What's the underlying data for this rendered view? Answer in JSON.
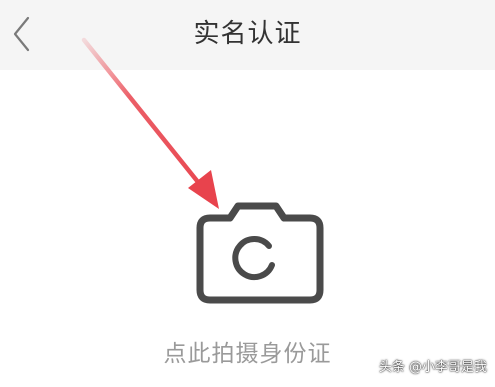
{
  "header": {
    "back_icon": "chevron-left-icon",
    "title": "实名认证"
  },
  "main": {
    "camera_icon": "camera-icon",
    "capture_label": "点此拍摄身份证"
  },
  "annotation": {
    "arrow_color": "#e8434d"
  },
  "watermark": {
    "text": "头条 @小李哥是我"
  },
  "colors": {
    "header_bg": "#f5f5f5",
    "title": "#333333",
    "camera_stroke": "#4a4a4a",
    "label": "#9a9a9a"
  }
}
